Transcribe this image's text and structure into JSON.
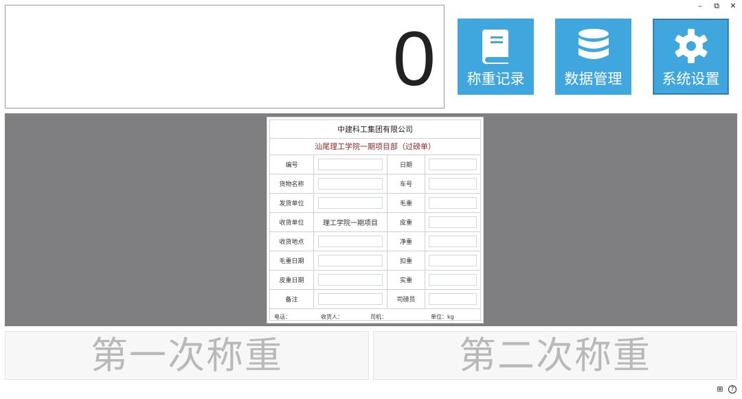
{
  "window": {
    "minimize_glyph": "–",
    "restore_glyph": "⧉",
    "close_glyph": "✕"
  },
  "display": {
    "weight": "0"
  },
  "tiles": {
    "records": {
      "label": "称重记录",
      "icon": "book-icon"
    },
    "data": {
      "label": "数据管理",
      "icon": "database-icon"
    },
    "settings": {
      "label": "系统设置",
      "icon": "gear-icon"
    }
  },
  "colors": {
    "tile": "#3fa7de",
    "preview_bg": "#7f7f81",
    "subtitle": "#8a2a2a"
  },
  "ticket": {
    "company": "中建科工集团有限公司",
    "subtitle": "汕尾理工学院一期项目部（过磅单）",
    "rows": [
      {
        "l1": "编号",
        "v1": "",
        "l2": "日期",
        "v2": ""
      },
      {
        "l1": "货物名称",
        "v1": "",
        "l2": "车号",
        "v2": ""
      },
      {
        "l1": "发货单位",
        "v1": "",
        "l2": "毛重",
        "v2": ""
      },
      {
        "l1": "收货单位",
        "v1": "理工学院一期项目",
        "l2": "皮重",
        "v2": ""
      },
      {
        "l1": "收货地点",
        "v1": "",
        "l2": "净重",
        "v2": ""
      },
      {
        "l1": "毛重日期",
        "v1": "",
        "l2": "扣重",
        "v2": ""
      },
      {
        "l1": "皮重日期",
        "v1": "",
        "l2": "实重",
        "v2": ""
      },
      {
        "l1": "备注",
        "v1": "",
        "l2": "司磅员",
        "v2": ""
      }
    ],
    "footer": {
      "phone": "电话：",
      "receiver": "收货人：",
      "driver": "司机：",
      "unit": "单位：kg"
    }
  },
  "buttons": {
    "first": "第一次称重",
    "second": "第二次称重"
  },
  "corner": {
    "grid_glyph": "⊞",
    "help_glyph": "?"
  }
}
